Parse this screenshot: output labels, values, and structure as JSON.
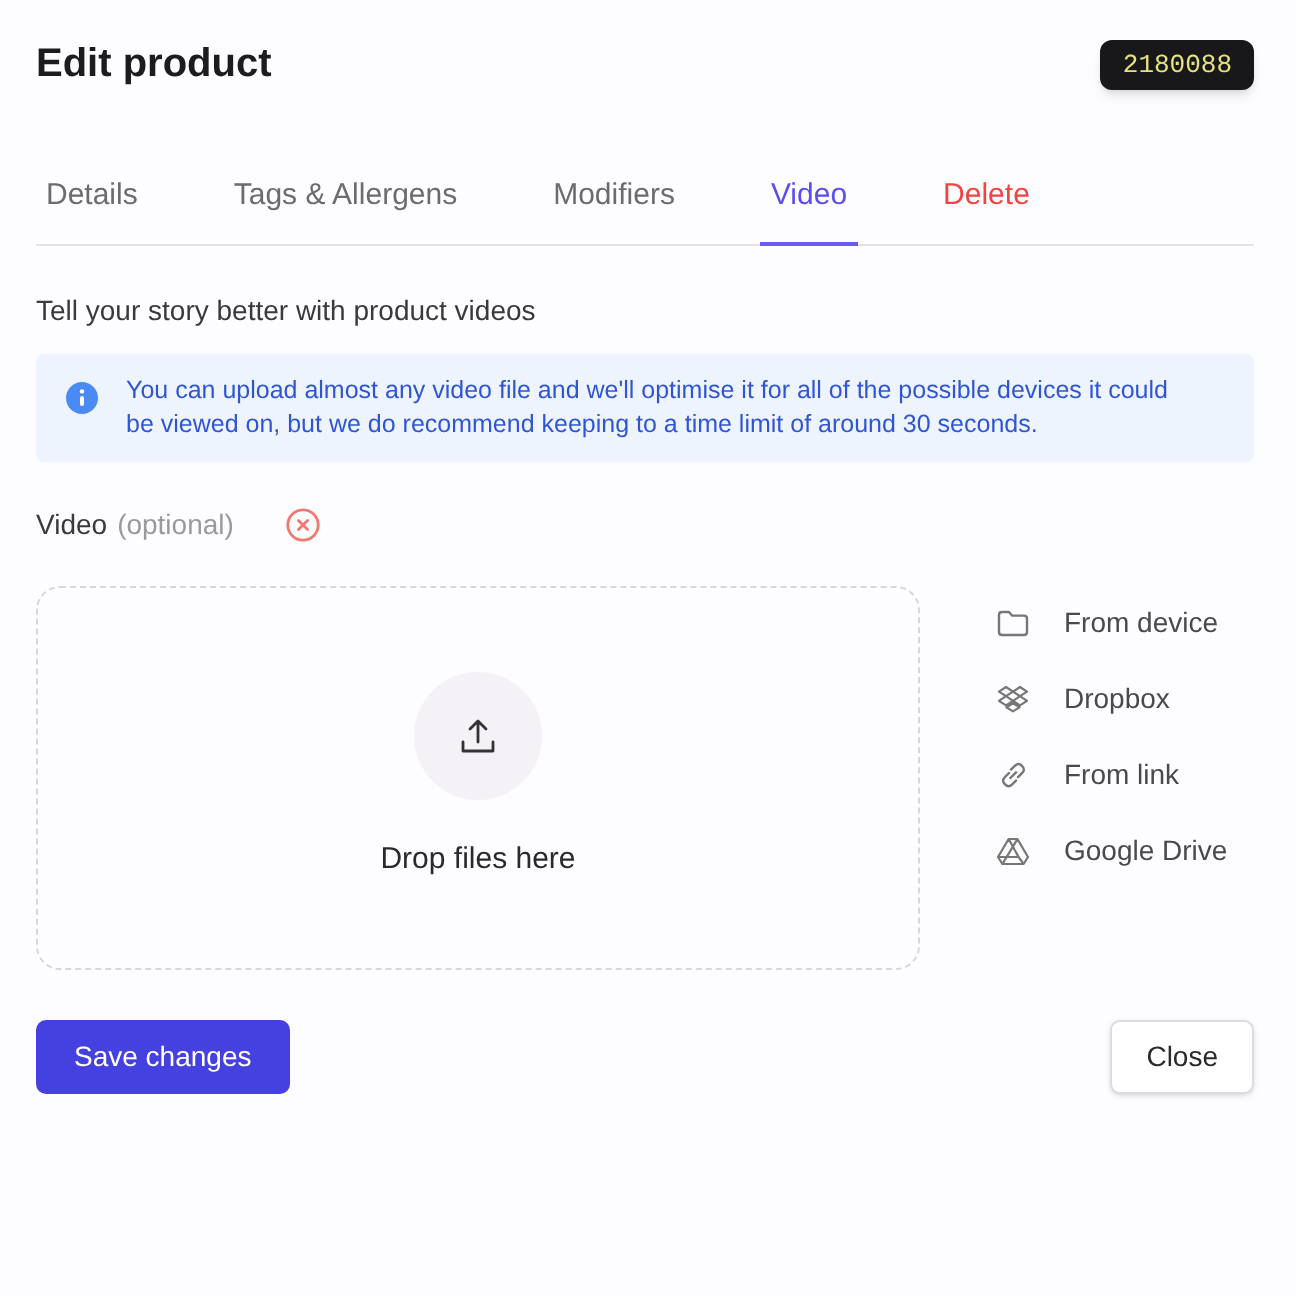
{
  "header": {
    "title": "Edit product",
    "id_badge": "2180088"
  },
  "tabs": [
    {
      "label": "Details",
      "selected": false,
      "kind": "normal"
    },
    {
      "label": "Tags & Allergens",
      "selected": false,
      "kind": "normal"
    },
    {
      "label": "Modifiers",
      "selected": false,
      "kind": "normal"
    },
    {
      "label": "Video",
      "selected": true,
      "kind": "normal"
    },
    {
      "label": "Delete",
      "selected": false,
      "kind": "danger"
    }
  ],
  "section": {
    "heading": "Tell your story better with product videos"
  },
  "info_alert": {
    "text": "You can upload almost any video file and we'll optimise it for all of the possible devices it could be viewed on, but we do recommend keeping to a time limit of around 30 seconds."
  },
  "video_field": {
    "label": "Video",
    "hint": "(optional)"
  },
  "dropzone": {
    "text": "Drop files here"
  },
  "sources": [
    {
      "label": "From device",
      "kind": "device"
    },
    {
      "label": "Dropbox",
      "kind": "dropbox"
    },
    {
      "label": "From link",
      "kind": "link"
    },
    {
      "label": "Google Drive",
      "kind": "drive"
    }
  ],
  "buttons": [
    {
      "label": "Save changes",
      "kind": "primary"
    },
    {
      "label": "Close",
      "kind": "secondary"
    }
  ]
}
